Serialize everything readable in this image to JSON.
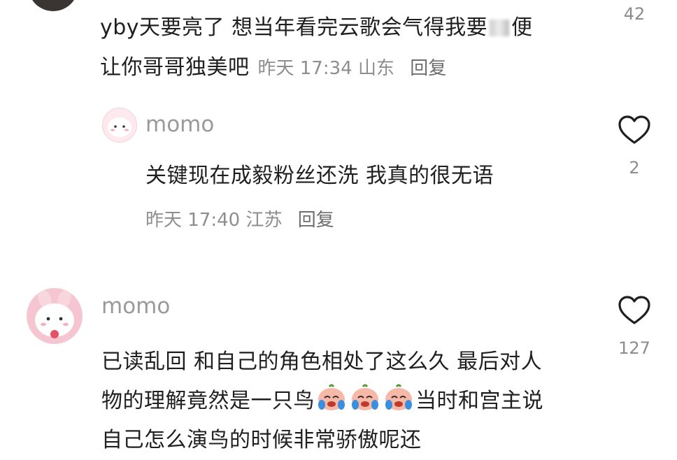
{
  "comment1": {
    "text_line1": "yby天要亮了 想当年看完云歌会气得我要",
    "text_line1_end": "便",
    "text_line2": "让你哥哥独美吧",
    "time": "昨天 17:34",
    "location": "山东",
    "reply_label": "回复",
    "like_count": "42"
  },
  "reply1": {
    "username": "momo",
    "text": "关键现在成毅粉丝还洗 我真的很无语",
    "time": "昨天 17:40",
    "location": "江苏",
    "reply_label": "回复",
    "like_count": "2"
  },
  "comment2": {
    "username": "momo",
    "text_line1": "已读乱回 和自己的角色相处了这么久 最后对人",
    "text_line2_a": "物的理解竟然是一只鸟",
    "text_line2_b": "当时和宫主说",
    "text_line3": "自己怎么演鸟的时候非常骄傲呢还",
    "like_count": "127"
  },
  "icons": {
    "like": "heart-outline-icon",
    "emoji": "crying-face-emoji"
  },
  "colors": {
    "text": "#1f1f1f",
    "meta": "#8e8e8e",
    "username": "#9a9a9a",
    "avatar_pink": "#f4c3cf"
  }
}
